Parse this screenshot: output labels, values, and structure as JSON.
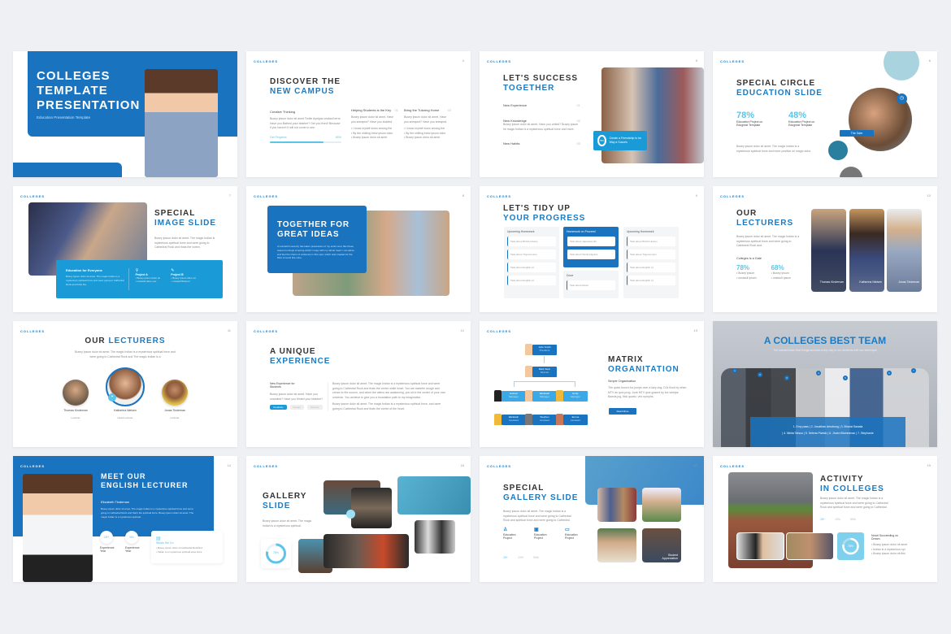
{
  "brand": "COLLEGES",
  "colors": {
    "primary": "#1a73bf",
    "accent": "#1a9ad6",
    "light_accent": "#5bc4e8",
    "dark_text": "#333333",
    "background": "#eef0f4"
  },
  "slides": [
    {
      "title_lines": [
        "COLLEGES",
        "TEMPLATE",
        "PRESENTATION"
      ],
      "subtitle": "Education Presentation Template"
    },
    {
      "number": "4",
      "title": "DISCOVER THE",
      "title_accent": "NEW CAMPUS",
      "col1_heading": "Creative Thinking",
      "col1_text": "Busey ipsum dolor sit amet Tonite Ayelgus unstaoll error Have you Bathed your blabber? Get you fixed! Because if you haven't it will not come to see.",
      "progress_label": "Get Progress",
      "progress_value": "80%",
      "progress_fraction": 0.75,
      "col2_heading": "Helping Students is the Key",
      "col2_num": "01",
      "col2_text": "Busey ipsum dolor sit amet. Have you sneaped? Have you shaded.",
      "col2_bullets": [
        "I know myself down among the",
        "By the shilling brew ipsum dolor",
        "Busey ipsum dolor sit amet"
      ],
      "col3_heading": "Bring the Tutoring Home",
      "col3_num": "02",
      "col3_text": "Busey ipsum dolor sit amet. Have you sneaped? Have you sneaped.",
      "col3_bullets": [
        "I know myself down among the",
        "By the shilling brew ipsum dolor",
        "Busey ipsum dolor sit amet"
      ]
    },
    {
      "number": "5",
      "title": "LET'S SUCCESS",
      "title_accent": "TOGETHER",
      "items": [
        {
          "label": "New Experience",
          "num": "01"
        },
        {
          "label": "New Knowledge",
          "num": "02",
          "text": "Busey ipsum dolor sit amet. Have you untied? Busey ipsum he magic Indian is a mysterious spiritual force and more."
        },
        {
          "label": "New Habits",
          "num": "03"
        }
      ],
      "callout_percent": "78%",
      "callout_text": "Create a Friendship to be Way a Succes"
    },
    {
      "number": "6",
      "title": "SPECIAL CIRCLE",
      "title_accent": "EDUCATION SLIDE",
      "stats": [
        {
          "value": "78%",
          "letter": "A",
          "label": "Education Project on Edugreat Template"
        },
        {
          "value": "48%",
          "letter": "B",
          "label": "Education Project on Edugreat Template"
        }
      ],
      "text": "Busey ipsum dolor sit amet. The magic Indian is a mysterious spiritual force and more positive on magic dolor.",
      "badge": "The Gate"
    },
    {
      "number": "7",
      "title": "SPECIAL",
      "title_accent": "IMAGE SLIDE",
      "text": "Busey ipsum dolor sit amet. The magic Indian is mysterious spiritual force and were going to Cathedral Rock and thats the vortex.",
      "box_heading": "Education for Everyone",
      "box_text": "Busey ipsum dolor sit amet. The magic Indian is a mysterious spiritual force and were going to Cathedral Rock and thats the.",
      "projects": [
        {
          "label": "Project A",
          "bullets": [
            "Busey ipsum dolor sit",
            "unstaoll Have you"
          ]
        },
        {
          "label": "Project B",
          "bullets": [
            "Busey ipsum dolor sit",
            "unstaoll Bustout"
          ]
        }
      ]
    },
    {
      "number": "8",
      "title_lines": [
        "TOGETHER FOR",
        "GREAT IDEAS"
      ],
      "text": "A wonderful serenity has taken possession of my entire soul, like these sweet mornings of spring which I enjoy with my whole heart. I am alone, and feel the charm of existence in this spot, which was created for the bliss of souls like mine."
    },
    {
      "number": "9",
      "title": "LET'S TIDY UP",
      "title_accent": "YOUR PROGRESS",
      "columns": [
        {
          "heading": "Upcoming Homework",
          "items": [
            "Task about British History",
            "Task about Trigonometry",
            "Task about English Lit",
            "Task about English Lit"
          ]
        },
        {
          "heading": "Homework on Proceed",
          "items": [
            "Task about Japanese life",
            "Task about World Algebra"
          ],
          "done_heading": "Done",
          "done_items": [
            "Task about Rules"
          ]
        },
        {
          "heading": "Upcoming Homework",
          "items": [
            "Task about British History",
            "Task about Trigonometry",
            "Task about English Lit",
            "Task about English Lit"
          ]
        }
      ]
    },
    {
      "number": "10",
      "title": "OUR",
      "title_accent": "LECTURERS",
      "text": "Busey ipsum dolor sit amet. The magic Indian is a mysterious spiritual force and were going to Cathedral Rock and.",
      "sub_heading": "Colleges is a Gate",
      "stats": [
        {
          "value": "78%",
          "letter": "A",
          "bullets": [
            "Busey ipsum",
            "unstaoll ipsum"
          ]
        },
        {
          "value": "68%",
          "letter": "B",
          "bullets": [
            "Busey ipsum",
            "unstaoll ipsum"
          ]
        }
      ],
      "people": [
        {
          "name": "Thomas Kindervan",
          "role": "Lecturer"
        },
        {
          "name": "Katherina Nielsen",
          "role": "Lecturer"
        },
        {
          "name": "Jonas Tindeman",
          "role": "Lecturer"
        }
      ]
    },
    {
      "number": "11",
      "title": "OUR",
      "title_accent": "LECTURERS",
      "text": "Busey ipsum dolor sit amet. The magic Indian is a mysterious spiritual force and were going to Cathedral Rock and The magic Indian is a",
      "people": [
        {
          "name": "Thomas Kindervan",
          "role": "Lecturer"
        },
        {
          "name": "Katherina Nielsen",
          "role": "Head Lecturer"
        },
        {
          "name": "Jonas Tindeman",
          "role": "Lecturer"
        }
      ]
    },
    {
      "number": "12",
      "title": "A UNIQUE",
      "title_accent": "EXPERIENCE",
      "side_heading": "New Experience for Students",
      "side_text": "Busey ipsum dolor sit amet. Have you unsealed? Have you frinted your blabber?",
      "tabs": [
        "Creativity",
        "Design",
        "Science"
      ],
      "body_para1": "Busey ipsum dolor sit amet. The magic Indian is a mysterious spiritual force and were going to Cathedral Rock and thats the vortex while heart. You are sweeter dough and cream to the source, and when the aliens are awakening, you sit in the center of your own universe. You achieve to give you a foundation path to my imagination.",
      "body_para2": "Busey ipsum dolor sit amet. The magic Indian is a mysterious spiritual force, and were going to Cathedral Rock and thats the vortex of the heart."
    },
    {
      "number": "13",
      "title": "MATRIX",
      "title_accent": "ORGANITATION",
      "sub_heading": "Simple Organisation",
      "text": "The quick brown fox jumps over a lazy dog. DJs flock by when MTV ax quiz prog. Junk MTV quiz graced by fox whelps. Bawds jog, flick quartz, vex nymphs.",
      "button": "Read More",
      "org": [
        {
          "name": "John Smith",
          "role": "President"
        },
        {
          "name": "Mark Stein",
          "role": "Director"
        },
        {
          "name": "Hudson",
          "role": "Manager"
        },
        {
          "name": "Elizabeth",
          "role": "Manager"
        },
        {
          "name": "Emily",
          "role": "Manager"
        },
        {
          "name": "Elizabeth",
          "role": "Assistant"
        },
        {
          "name": "Stephen",
          "role": "Assistant"
        },
        {
          "name": "Emma",
          "role": "Assistant"
        }
      ]
    },
    {
      "title": "A COLLEGES BEST TEAM",
      "subtitle": "The wanted team that brings success every day to our students with our technique",
      "markers": [
        "1",
        "2",
        "3",
        "4",
        "5",
        "6",
        "7"
      ],
      "names_line1": "1. Emy pass | 2. Jonathan Amstrong | 3. Bharat Sawala",
      "names_line2": "| 4. Nikita Tatsuo | 5. Selena Patrick | 6. Jhoen Blummman | 7. Stephanie"
    },
    {
      "number": "14",
      "title_lines": [
        "MEET OUR",
        "ENGLISH LECTURER"
      ],
      "name": "Elizabeth Tindeman",
      "text": "Busey ipsum dolor sit amet. The magic Indian is a mysterious spiritual force and we're going to Cathedral Rock and that's the spiritual force. Busey ipsum dolor sit amet. The magic Indian is a mysterious spiritual.",
      "stats": [
        {
          "value": "28+",
          "label": "Experience Year"
        },
        {
          "value": "5th",
          "label": "Experience Year"
        }
      ],
      "card_heading": "Whats We Do",
      "card_bullets": [
        "Busey ipsum dolor sit Cathedral Rockfind",
        "Indian is a mysterious spiritual area force"
      ]
    },
    {
      "number": "16",
      "title": "GALLERY",
      "title_accent": "SLIDE",
      "text": "Busey ipsum dolor sit amet. The magic Indian is a mysterious spiritual.",
      "donut_value": "78%",
      "donut_fraction": 0.78
    },
    {
      "number": "17",
      "title": "SPECIAL",
      "title_accent": "GALLERY SLIDE",
      "text": "Busey ipsum dolor sit amet. The magic Indian is a mysterious spiritual force and were going to Cathedral Rock and spiritual force and were going to Cathedral.",
      "features": [
        {
          "label": "Education Project"
        },
        {
          "label": "Education Project"
        },
        {
          "label": "Education Project"
        }
      ],
      "stats": [
        "28+",
        "13%",
        "50th"
      ],
      "photo_caption": "Student Appreciation"
    },
    {
      "number": "19",
      "title": "ACTIVITY",
      "title_accent": "IN COLLEGES",
      "text": "Busey ipsum dolor sit amet. The magic Indian is a mysterious spiritual force and were going to Cathedral Rock and spiritual force and were going to Cathedral.",
      "stats": [
        "28+",
        "13%",
        "50th"
      ],
      "donut_value": "78%",
      "donut_fraction": 0.78,
      "list_heading": "Novel Succeeding on Dream",
      "list_bullets": [
        "Busey ipsum dolor sit amet",
        "Indian is a mysterious spi",
        "Busey ipsum dolor sit this"
      ]
    }
  ]
}
